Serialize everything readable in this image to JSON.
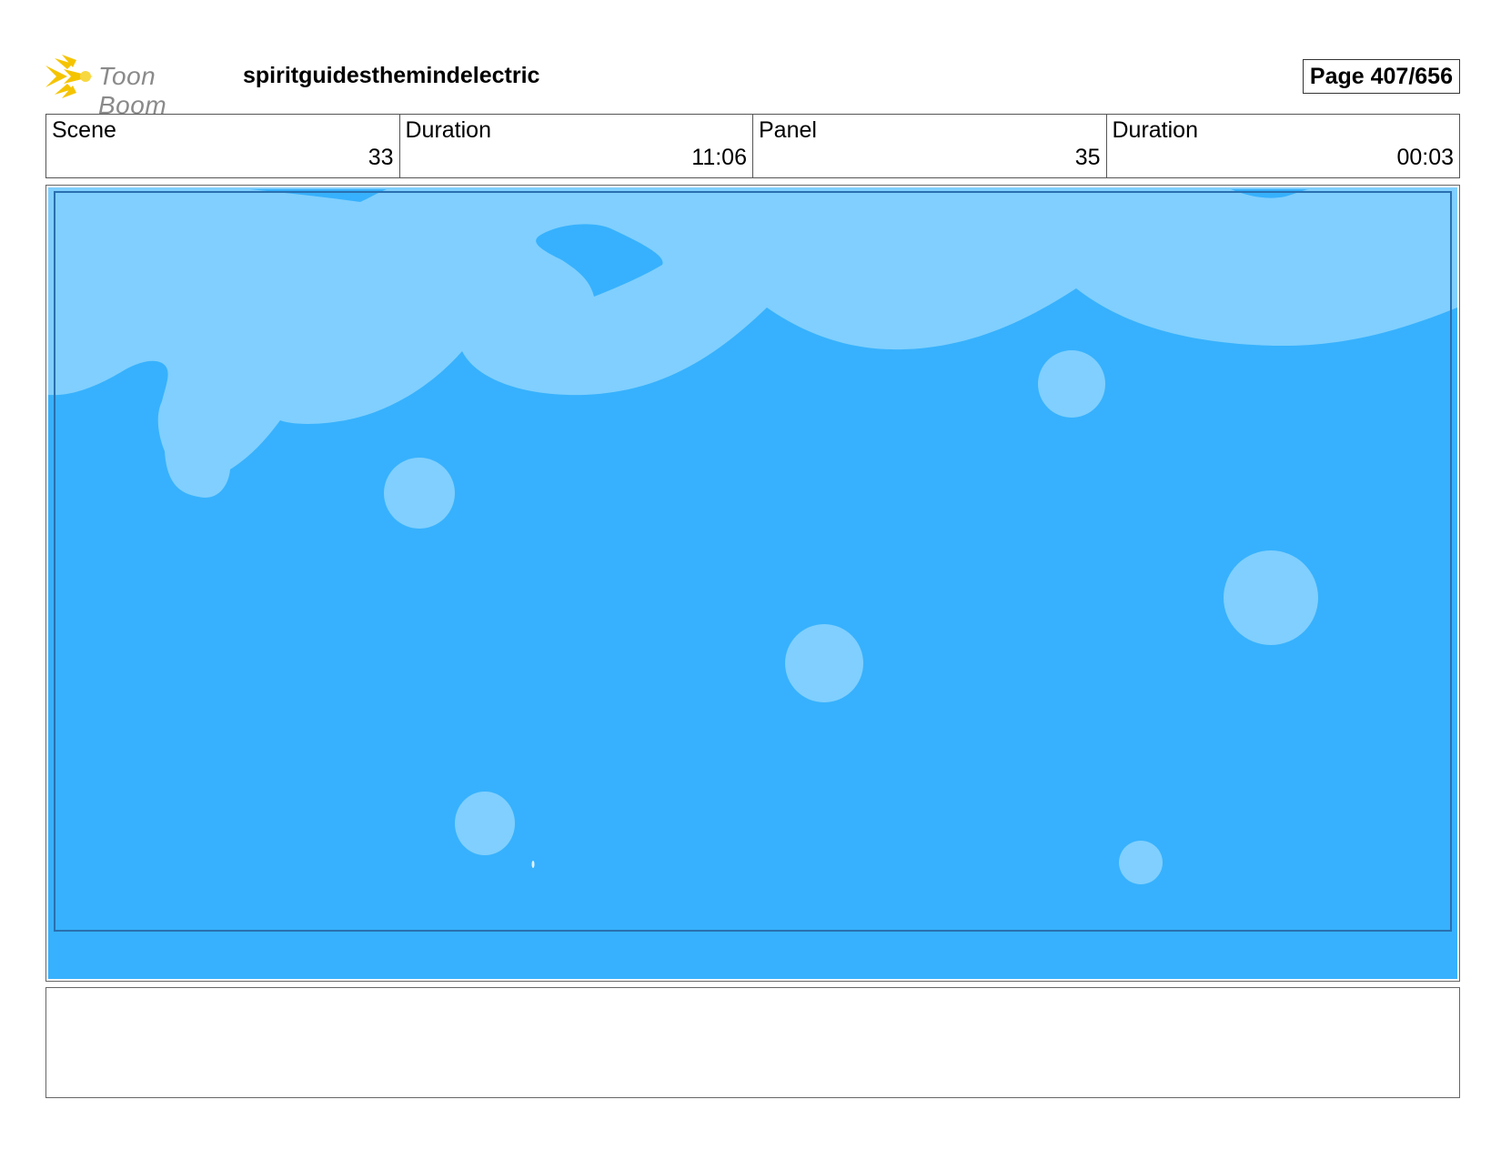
{
  "header": {
    "logo_text": "Toon Boom",
    "title": "spiritguidesthemindelectric",
    "page_label": "Page 407/656"
  },
  "info": [
    {
      "label": "Scene",
      "value": "33"
    },
    {
      "label": "Duration",
      "value": "11:06"
    },
    {
      "label": "Panel",
      "value": "35"
    },
    {
      "label": "Duration",
      "value": "00:03"
    }
  ],
  "panel": {
    "colors": {
      "water": "#37b1fd",
      "foam": "#80cffe",
      "frame_line": "#2a6fb0"
    }
  },
  "notes": {
    "text": ""
  }
}
